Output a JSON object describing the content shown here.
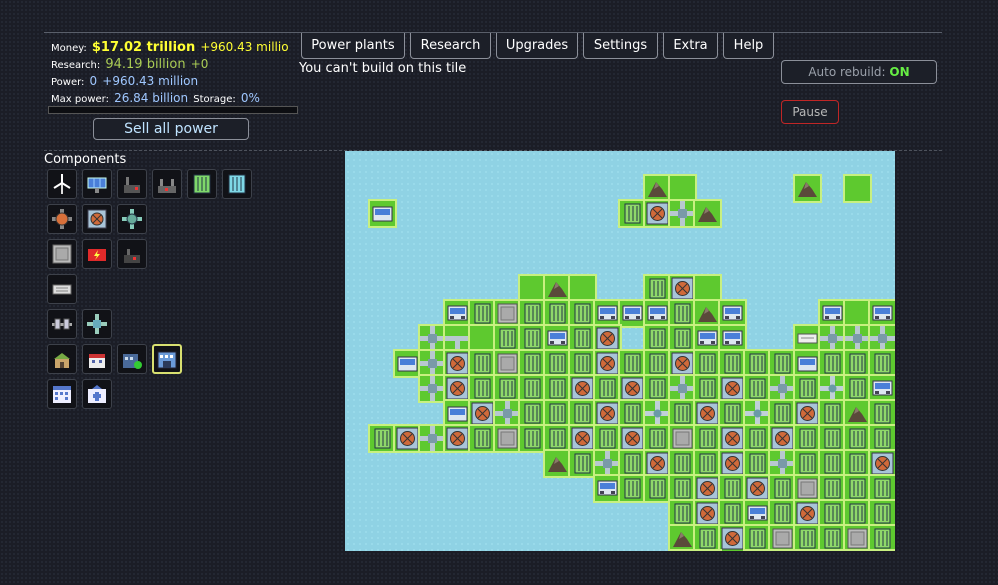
{
  "stats": {
    "money_label": "Money:",
    "money_value": "$17.02 trillion",
    "money_delta": "+960.43 millio",
    "research_label": "Research:",
    "research_value": "94.19 billion",
    "research_delta": "+0",
    "power_label": "Power:",
    "power_value": "0",
    "power_delta": "+960.43 million",
    "maxpower_label": "Max power:",
    "maxpower_value": "26.84 billion",
    "storage_label": "Storage:",
    "storage_value": "0%"
  },
  "sell_label": "Sell all power",
  "tabs": [
    "Power plants",
    "Research",
    "Upgrades",
    "Settings",
    "Extra",
    "Help"
  ],
  "message": "You can't build on this tile",
  "auto_rebuild": {
    "label": "Auto rebuild:",
    "state": "ON"
  },
  "pause_label": "Pause",
  "components_title": "Components",
  "components": [
    [
      "wind-turbine-icon",
      "solar-panel-icon",
      "coal-plant-icon",
      "oil-plant-icon",
      "battery-icon",
      "battery-large-icon"
    ],
    [
      "heat-exchanger-icon",
      "reactor-core-icon",
      "cooling-fan-icon"
    ],
    [
      "metal-plate-icon",
      "red-generator-icon",
      "factory-icon"
    ],
    [
      "isolator-icon"
    ],
    [
      "small-pipe-icon",
      "pipe-cross-icon"
    ],
    [
      "house-small-icon",
      "house-medium-icon",
      "house-wrench-icon",
      "house-selected-icon"
    ],
    [
      "apartment-icon",
      "hospital-icon"
    ]
  ],
  "colors": {
    "money": "#ffff33",
    "research": "#aacc55",
    "power": "#9fc7ff",
    "water": "#8fd2e4",
    "grass": "#5ec92f",
    "auto_on": "#66ee44",
    "pause_border": "#c02626"
  }
}
